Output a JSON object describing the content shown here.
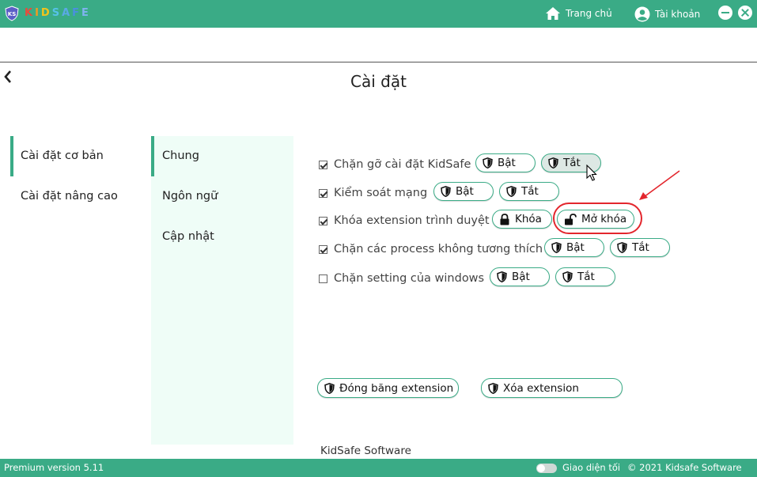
{
  "header": {
    "brand_letters": [
      "K",
      "I",
      "D",
      "S",
      "A",
      "F",
      "E"
    ],
    "logo_text": "KS",
    "nav_home": "Trang chủ",
    "nav_account": "Tài khoản"
  },
  "page": {
    "title": "Cài đặt"
  },
  "menu_primary": [
    {
      "label": "Cài đặt cơ bản",
      "active": true
    },
    {
      "label": "Cài đặt nâng cao",
      "active": false
    }
  ],
  "menu_secondary": [
    {
      "label": "Chung",
      "active": true
    },
    {
      "label": "Ngôn ngữ",
      "active": false
    },
    {
      "label": "Cập nhật",
      "active": false
    }
  ],
  "settings": [
    {
      "label": "Chặn gỡ cài đặt KidSafe",
      "checked": true,
      "on": "Bật",
      "off": "Tắt"
    },
    {
      "label": "Kiểm soát mạng",
      "checked": true,
      "on": "Bật",
      "off": "Tắt"
    },
    {
      "label": "Khóa extension trình duyệt",
      "checked": true,
      "lock": "Khóa",
      "unlock": "Mở khóa"
    },
    {
      "label": "Chặn các process không tương thích",
      "checked": true,
      "on": "Bật",
      "off": "Tắt"
    },
    {
      "label": "Chặn setting của windows",
      "checked": false,
      "on": "Bật",
      "off": "Tắt"
    }
  ],
  "actions": {
    "freeze": "Đóng băng extension",
    "delete": "Xóa extension"
  },
  "footer_partial": "KidSafe Software",
  "statusbar": {
    "version": "Premium version 5.11",
    "dark_mode": "Giao diện tối",
    "copyright": "© 2021 Kidsafe Software"
  },
  "colors": {
    "primary": "#3aab86",
    "panel": "#effdf7",
    "highlight": "#e3262d"
  }
}
